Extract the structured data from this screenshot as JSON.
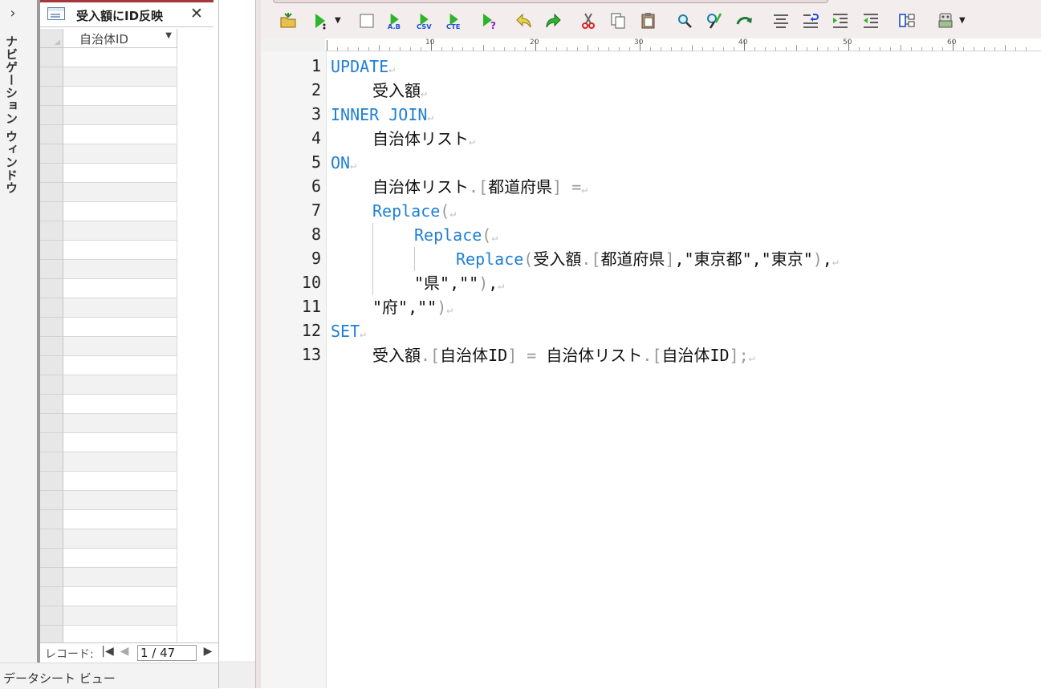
{
  "nav_pane": {
    "expand_glyph": "›",
    "title": "ナビゲーション ウィンドウ"
  },
  "datasheet": {
    "tab_title": "受入額にID反映",
    "close_glyph": "✕",
    "column_header": "自治体ID",
    "record_nav": {
      "label": "レコード:",
      "first_glyph": "|◀",
      "prev_glyph": "◀",
      "current": "1 / 47",
      "next_glyph": "▶"
    }
  },
  "status_bar": {
    "view_label": "データシート ビュー"
  },
  "toolbar": {
    "buttons": [
      "open-folder-icon",
      "run-icon",
      "new-icon",
      "run-ab-icon",
      "export-csv-icon",
      "cte-icon",
      "run-help-icon",
      "undo-icon",
      "redo-icon",
      "cut-icon",
      "copy-icon",
      "paste-icon",
      "search-icon",
      "replace-icon",
      "goto-icon",
      "align-icon",
      "wrap-icon",
      "indent-icon",
      "outdent-icon",
      "structure-icon",
      "plugin-icon"
    ],
    "ab_text": "A.B",
    "csv_text": "CSV",
    "cte_text": "CTE",
    "help_text": "?"
  },
  "ruler": {
    "labels": [
      "10",
      "20",
      "30",
      "40",
      "50",
      "60"
    ]
  },
  "editor": {
    "eol_mark": "↵",
    "lines": [
      {
        "n": "1",
        "indent": 0,
        "parts": [
          [
            "kw",
            "UPDATE"
          ]
        ]
      },
      {
        "n": "2",
        "indent": 1,
        "parts": [
          [
            "tx",
            "受入額"
          ]
        ]
      },
      {
        "n": "3",
        "indent": 0,
        "parts": [
          [
            "kw",
            "INNER JOIN"
          ]
        ]
      },
      {
        "n": "4",
        "indent": 1,
        "parts": [
          [
            "tx",
            "自治体リスト"
          ]
        ]
      },
      {
        "n": "5",
        "indent": 0,
        "parts": [
          [
            "kw",
            "ON"
          ]
        ]
      },
      {
        "n": "6",
        "indent": 1,
        "parts": [
          [
            "tx",
            "自治体リスト"
          ],
          [
            "op",
            "."
          ],
          [
            "op",
            "["
          ],
          [
            "tx",
            "都道府県"
          ],
          [
            "op",
            "]"
          ],
          [
            "tx",
            " "
          ],
          [
            "op",
            "="
          ]
        ]
      },
      {
        "n": "7",
        "indent": 1,
        "parts": [
          [
            "kw",
            "Replace"
          ],
          [
            "op",
            "("
          ]
        ]
      },
      {
        "n": "8",
        "indent": 2,
        "parts": [
          [
            "kw",
            "Replace"
          ],
          [
            "op",
            "("
          ]
        ]
      },
      {
        "n": "9",
        "indent": 3,
        "parts": [
          [
            "kw",
            "Replace"
          ],
          [
            "op",
            "("
          ],
          [
            "tx",
            "受入額"
          ],
          [
            "op",
            "."
          ],
          [
            "op",
            "["
          ],
          [
            "tx",
            "都道府県"
          ],
          [
            "op",
            "]"
          ],
          [
            "tx",
            ",\"東京都\",\"東京\""
          ],
          [
            "op",
            ")"
          ],
          [
            "tx",
            ","
          ]
        ]
      },
      {
        "n": "10",
        "indent": 2,
        "parts": [
          [
            "tx",
            "\"県\",\"\""
          ],
          [
            "op",
            ")"
          ],
          [
            "tx",
            ","
          ]
        ]
      },
      {
        "n": "11",
        "indent": 1,
        "parts": [
          [
            "tx",
            "\"府\",\"\""
          ],
          [
            "op",
            ")"
          ]
        ]
      },
      {
        "n": "12",
        "indent": 0,
        "parts": [
          [
            "kw",
            "SET"
          ]
        ]
      },
      {
        "n": "13",
        "indent": 1,
        "parts": [
          [
            "tx",
            "受入額"
          ],
          [
            "op",
            "."
          ],
          [
            "op",
            "["
          ],
          [
            "tx",
            "自治体ID"
          ],
          [
            "op",
            "]"
          ],
          [
            "tx",
            " "
          ],
          [
            "op",
            "="
          ],
          [
            "tx",
            " 自治体リスト"
          ],
          [
            "op",
            "."
          ],
          [
            "op",
            "["
          ],
          [
            "tx",
            "自治体ID"
          ],
          [
            "op",
            "]"
          ],
          [
            "op",
            ";"
          ]
        ]
      }
    ]
  },
  "colors": {
    "keyword": "#1e7fd6",
    "punctuation": "#999999",
    "tab_accent": "#a4373a",
    "frame": "#ece4e4"
  }
}
